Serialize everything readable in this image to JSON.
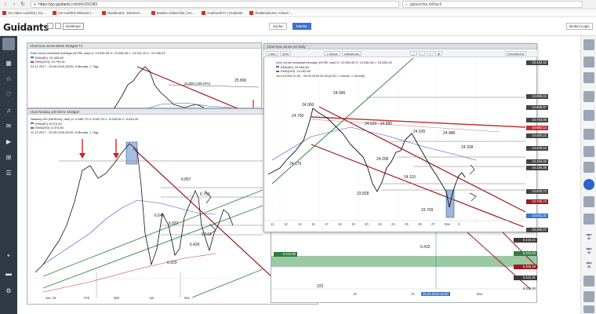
{
  "browser": {
    "url": "https://go.guidants.com/#c150183",
    "search_text": "galuschka drillisch"
  },
  "bookmarks": [
    "US Video Ausblick | Gu...",
    "US Ausblick Webinar | ...",
    "Dashboard - BörseGo ...",
    "Bastian Galuschka | Gu...",
    "GodmodeTV | Guidants",
    "Realtimekurse, Finanz-..."
  ],
  "header": {
    "logo_text": "Guidants",
    "desktop_label": "Desktops",
    "search_label": "Suche",
    "market_label": "Märkte",
    "login_label": "Broker-Login"
  },
  "chart_dow_stuttgart": {
    "window_title": "Chart Dow Jones Börse Stuttgart TV",
    "legend_name": "Dow Jones Industrial Average (NYSE, last)   O: 23.936,35  H: 23.996,26  L: 23.531,30  C: 23.938,29",
    "legend_ema50": "EMA(50): 24.430,65",
    "legend_ema200": "EMA(200): 23.795,51",
    "legend_range": "03.11.2017 - 03.05.2018   (EOD; 6 Monate, 1 Tag)",
    "annotation_peak": "25.800 (199.00%)",
    "annotation_level": "25.800"
  },
  "chart_nasdaq": {
    "window_title": "Chart Nasdaq 100 Börse Stuttgart",
    "legend_name": "Nasdaq 100 (NASDAQ, last)   O: 6.680,79  H: 6.667,29  L: 6.530,06  C: 6.643,40",
    "legend_ema50": "EMA(50): 6.673,40",
    "legend_ema200": "EMA(200): 6.374,80",
    "legend_range": "11.12.2017 - 03.05.2018   (EOD; 6 Monate, 1 Tag)",
    "levels": [
      "6.857",
      "6.750",
      "6.645",
      "6.587",
      "6.543",
      "6.426",
      "6.320"
    ],
    "x_labels": [
      "Jan '18",
      "Feb",
      "Mär",
      "Apr",
      "Mai"
    ],
    "price_labels": [
      "6.800,00",
      "6.600,00",
      "6.400,00",
      "6.200,00",
      "6.000,00"
    ]
  },
  "chart_dow_daily": {
    "window_title": "Chart Dow Jones US Daily",
    "toolbar": [
      "Chart",
      "Wert",
      "1 Monat",
      "Indikatoren"
    ],
    "toolbar_right": "Fixed/Bereit",
    "legend_name": "Dow Jones Industrial Average (NYSE, last)   O: 23.936,35  H: 23.936,35  L: 23.650,15",
    "legend_ema50": "EMA(50): 24.064,65",
    "legend_ema200": "EMA(200): 24.293,50",
    "legend_range": "16.04.2018 22:30 - 03.05.2018 22:30   (EOD; 1 Monat, 1 Stunde)",
    "levels": [
      "24.995",
      "24.900",
      "24.700",
      "24.620 - 24.880",
      "24.535",
      "24.486",
      "24.328",
      "24.208",
      "24.175",
      "24.110",
      "23.828",
      "23.709"
    ],
    "x_labels": [
      "11",
      "12",
      "13",
      "16",
      "17",
      "18",
      "19",
      "20",
      "23",
      "24",
      "25",
      "26",
      "27",
      "Mai",
      "3"
    ],
    "price_tags": [
      "25.432,42",
      "24.995,24",
      "24.858,97",
      "24.703,85",
      "24.582,12",
      "24.486,22",
      "24.328,54",
      "24.194,45",
      "24.106,25",
      "23.828,73",
      "23.708,73",
      "23.531,31",
      "23.360,27"
    ],
    "bottom_labels": [
      "19",
      "23",
      "25.04.2018 16:30",
      "Mai"
    ],
    "lower_tags": [
      "6.433,21",
      "6.322,60",
      "6.366,28",
      "6.322,91",
      "6.200,00"
    ],
    "lower_levels": [
      "6.432",
      "222"
    ]
  }
}
